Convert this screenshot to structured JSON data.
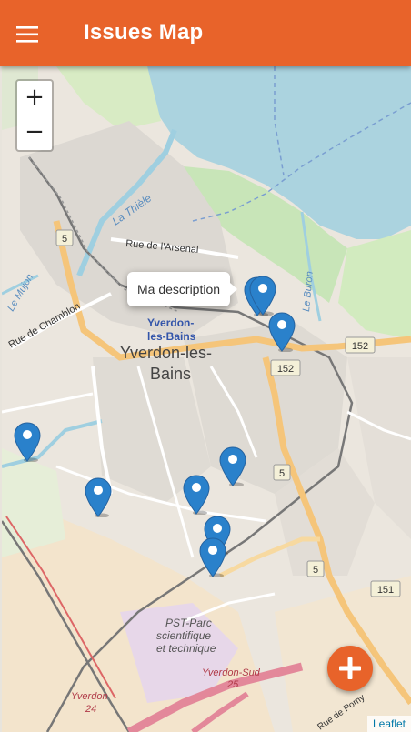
{
  "app_bar": {
    "title": "Issues Map",
    "menu_icon": "hamburger-menu-icon",
    "color": "#e8632a"
  },
  "map": {
    "zoom_in_label": "+",
    "zoom_out_label": "−",
    "popup_text": "Ma description",
    "attribution": "Leaflet",
    "place_labels": {
      "city": [
        "Yverdon-les-",
        "Bains"
      ],
      "station": [
        "Yverdon-",
        "les-Bains"
      ],
      "street_arsenal": "Rue de l'Arsenal",
      "street_chamblon": "Rue de Chamblon",
      "river_thiele": "La Thièle",
      "river_mujon": "Le Mujon",
      "river_buron": "Le Buron",
      "park": [
        "PST-Parc",
        "scientifique",
        "et technique"
      ],
      "station_sud": [
        "Yverdon-Sud",
        "25"
      ],
      "exit_24": [
        "Yverdon",
        "24"
      ],
      "street_pomy": "Rue de Pomy"
    },
    "road_shields": {
      "r5_a": "5",
      "r152_a": "152",
      "r152_b": "152",
      "r5_b": "5",
      "r5_c": "5",
      "r151": "151"
    },
    "marker_color": "#2a81cb",
    "marker_count": 9
  },
  "fab": {
    "icon": "plus-icon",
    "color": "#e8632a"
  }
}
